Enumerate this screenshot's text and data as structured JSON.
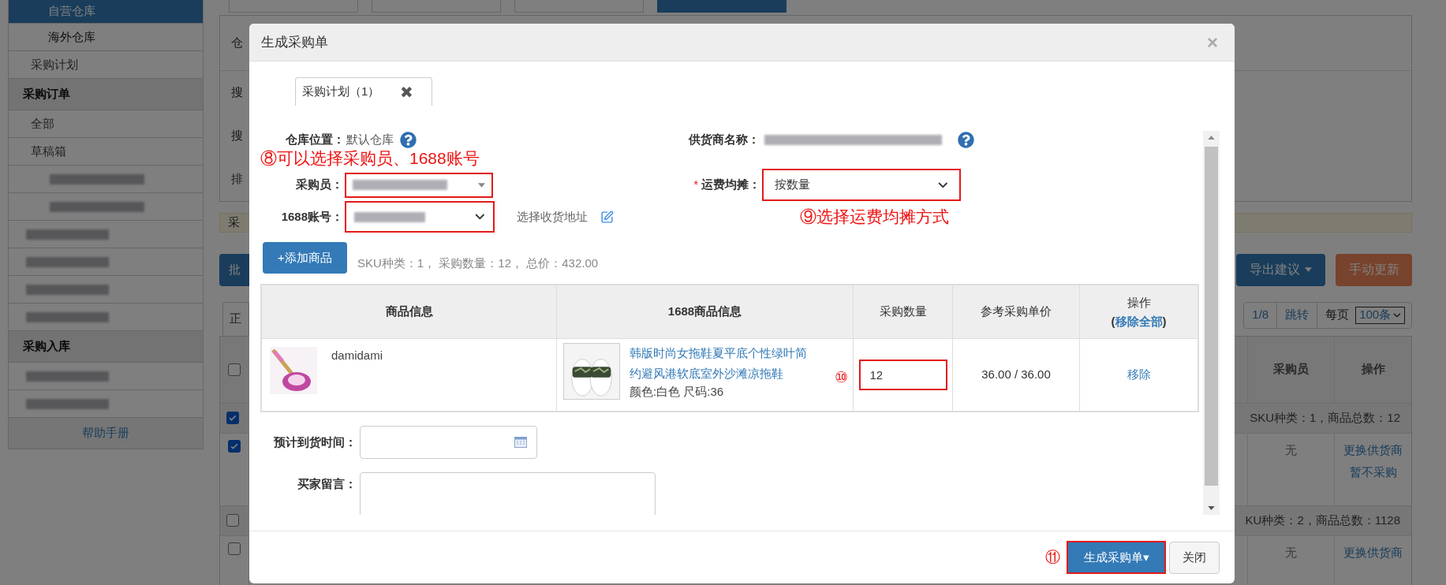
{
  "sidebar": {
    "items": [
      {
        "kind": "sub",
        "label": "自营仓库",
        "selected": true
      },
      {
        "kind": "sub",
        "label": "海外仓库",
        "selected": false
      },
      {
        "kind": "item",
        "label": "采购计划",
        "selected": false
      },
      {
        "kind": "header",
        "label": "采购订单",
        "selected": false
      },
      {
        "kind": "item",
        "label": "全部",
        "selected": false
      },
      {
        "kind": "item",
        "label": "草稿箱",
        "selected": false
      },
      {
        "kind": "redacted_sub",
        "selected": false
      },
      {
        "kind": "redacted_sub",
        "selected": false
      },
      {
        "kind": "redacted",
        "selected": false
      },
      {
        "kind": "redacted",
        "selected": false
      },
      {
        "kind": "redacted",
        "selected": false
      },
      {
        "kind": "redacted",
        "selected": false
      },
      {
        "kind": "header",
        "label": "采购入库",
        "selected": false
      },
      {
        "kind": "redacted",
        "selected": false
      },
      {
        "kind": "redacted",
        "selected": false
      },
      {
        "kind": "help",
        "label": "帮助手册",
        "selected": false
      }
    ]
  },
  "background": {
    "tabs": [
      {
        "selected": false
      },
      {
        "selected": false
      },
      {
        "selected": false
      },
      {
        "selected": true
      }
    ],
    "filter_labels": [
      "仓",
      "搜",
      "搜",
      "排"
    ],
    "alert": "采",
    "bulk_button": "批",
    "export_button": "导出建议",
    "update_button": "手动更新",
    "list_tab": "正",
    "pagination": {
      "page": "1/8",
      "jump": "跳转",
      "per_page_label": "每页",
      "per_page": "100条"
    },
    "table": {
      "header_checked": false,
      "columns": [
        "采购员",
        "操作"
      ],
      "groups": [
        {
          "checked": true,
          "summary": "SKU种类：1，商品总数：12",
          "rows": [
            {
              "checked": true,
              "buyer": "无",
              "actions": [
                "更换供货商",
                "暂不采购"
              ]
            }
          ]
        },
        {
          "checked": false,
          "summary": "KU种类：2，商品总数：1128",
          "rows": [
            {
              "checked": false,
              "buyer": "无",
              "actions": [
                "更换供货商"
              ]
            }
          ]
        }
      ]
    }
  },
  "modal": {
    "title": "生成采购单",
    "close": "×",
    "tabs": [
      {
        "label": "采购计划（1）",
        "close": "✖",
        "selected": true
      }
    ],
    "form": {
      "warehouse_label": "仓库位置：",
      "warehouse_value": "默认仓库",
      "supplier_label": "供货商名称：",
      "buyer_label": "采购员：",
      "freight_label": "运费均摊：",
      "freight_required_mark": "*",
      "freight_value": "按数量",
      "account_label": "1688账号：",
      "address_link": "选择收货地址"
    },
    "annotations": {
      "buyer": "⑧可以选择采购员、1688账号",
      "freight": "⑨选择运费均摊方式",
      "quantity": "⑩",
      "submit": "⑪"
    },
    "add_button": "+添加商品",
    "summary": "SKU种类：1， 采购数量：12， 总价：432.00",
    "table": {
      "columns": [
        "商品信息",
        "1688商品信息",
        "采购数量",
        "参考采购单价"
      ],
      "action_column": {
        "label": "操作",
        "open": "(",
        "link": "移除全部",
        "close": ")"
      },
      "rows": [
        {
          "sku": "damidami",
          "title": "韩版时尚女拖鞋夏平底个性绿叶简约避风港软底室外沙滩凉拖鞋",
          "spec": "颜色:白色 尺码:36",
          "quantity": "12",
          "price": "36.00 / 36.00",
          "action": "移除"
        }
      ]
    },
    "arrival_label": "预计到货时间：",
    "message_label": "买家留言：",
    "submit_button": "生成采购单▾",
    "close_button": "关闭"
  }
}
